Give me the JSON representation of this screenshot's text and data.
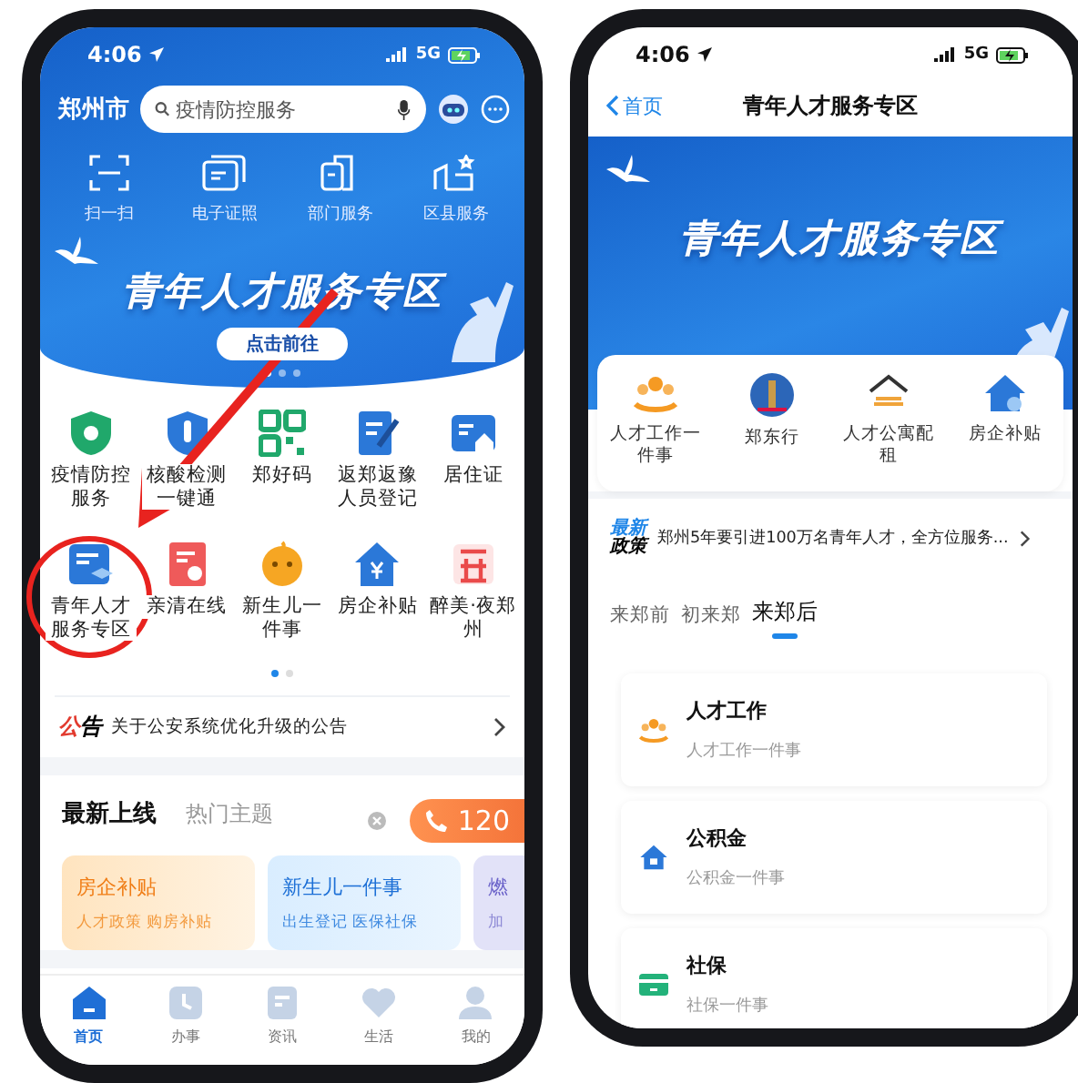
{
  "left_phone": {
    "status_bar": {
      "time": "4:06",
      "network": "5G"
    },
    "header": {
      "city": "郑州市",
      "search": {
        "placeholder": "疫情防控服务"
      }
    },
    "quick_actions": [
      {
        "label": "扫一扫"
      },
      {
        "label": "电子证照"
      },
      {
        "label": "部门服务"
      },
      {
        "label": "区县服务"
      }
    ],
    "banner": {
      "title": "青年人才服务专区",
      "button": "点击前往",
      "dots": [
        {
          "selected": true
        },
        {
          "selected": false
        },
        {
          "selected": false
        }
      ]
    },
    "services": [
      {
        "label": "疫情防控服务"
      },
      {
        "label": "核酸检测一键通"
      },
      {
        "label": "郑好码"
      },
      {
        "label": "返郑返豫人员登记"
      },
      {
        "label": "居住证"
      },
      {
        "label": "青年人才服务专区"
      },
      {
        "label": "亲清在线"
      },
      {
        "label": "新生儿一件事"
      },
      {
        "label": "房企补贴"
      },
      {
        "label": "醉美·夜郑州"
      }
    ],
    "service_pages": [
      {
        "selected": true
      },
      {
        "selected": false
      }
    ],
    "notice": {
      "label_first": "公",
      "label_second": "告",
      "text": "关于公安系统优化升级的公告"
    },
    "section_tabs": [
      {
        "label": "最新上线",
        "selected": true
      },
      {
        "label": "热门主题",
        "selected": false
      }
    ],
    "cards": [
      {
        "kind": "orange",
        "title": "房企补贴",
        "subtitle": "人才政策 购房补贴"
      },
      {
        "kind": "blue",
        "title": "新生儿一件事",
        "subtitle": "出生登记 医保社保"
      },
      {
        "kind": "purple",
        "title": "燃",
        "subtitle": "加"
      }
    ],
    "hotline": {
      "number": "120"
    },
    "bottom_nav": [
      {
        "label": "首页",
        "selected": true
      },
      {
        "label": "办事",
        "selected": false
      },
      {
        "label": "资讯",
        "selected": false
      },
      {
        "label": "生活",
        "selected": false
      },
      {
        "label": "我的",
        "selected": false
      }
    ]
  },
  "right_phone": {
    "status_bar": {
      "time": "4:06",
      "network": "5G"
    },
    "nav_bar": {
      "back": "首页",
      "title": "青年人才服务专区"
    },
    "banner": {
      "title": "青年人才服务专区"
    },
    "services": [
      {
        "label": "人才工作一件事"
      },
      {
        "label": "郑东行"
      },
      {
        "label": "人才公寓配租"
      },
      {
        "label": "房企补贴"
      }
    ],
    "policy": {
      "label_first": "最新",
      "label_second": "政策",
      "text": "郑州5年要引进100万名青年人才，全方位服务..."
    },
    "stage_tabs": [
      {
        "label": "来郑前",
        "selected": false
      },
      {
        "label": "初来郑",
        "selected": false
      },
      {
        "label": "来郑后",
        "selected": true
      }
    ],
    "items": [
      {
        "title": "人才工作",
        "subtitle": "人才工作一件事"
      },
      {
        "title": "公积金",
        "subtitle": "公积金一件事"
      },
      {
        "title": "社保",
        "subtitle": "社保一件事"
      }
    ]
  }
}
